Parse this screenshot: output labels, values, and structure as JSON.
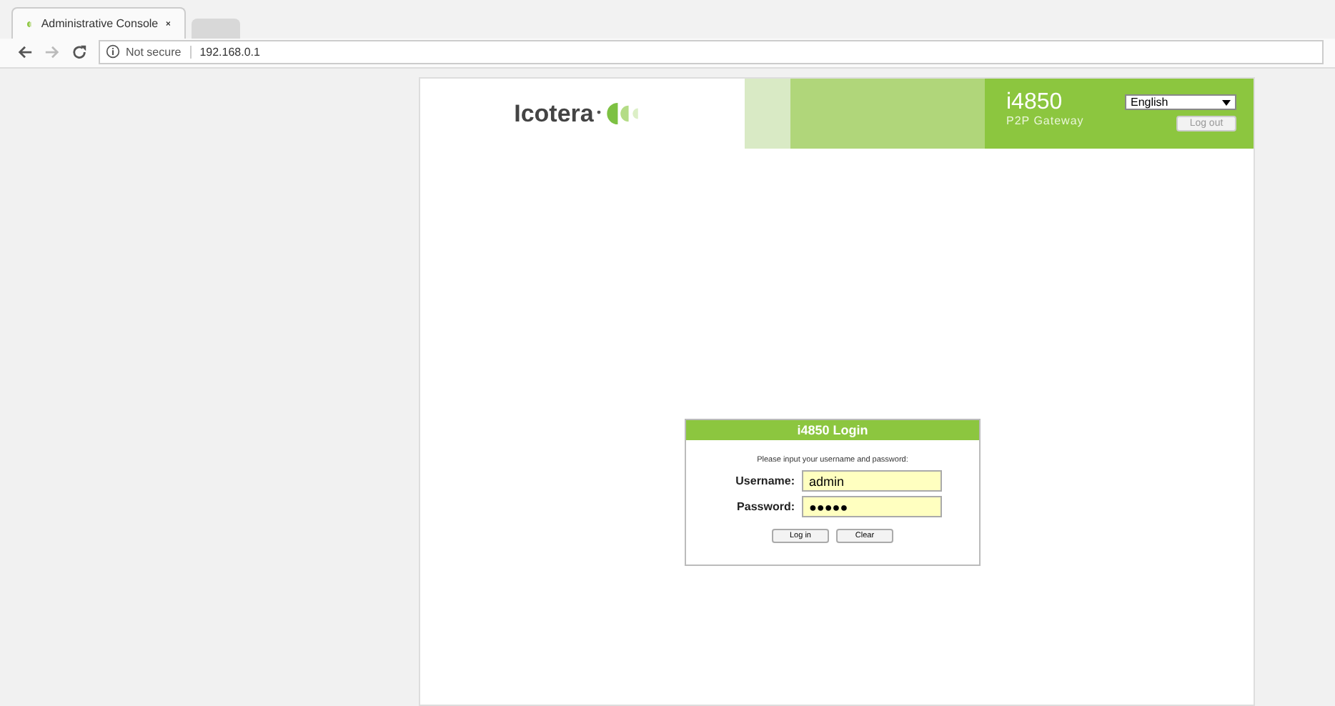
{
  "browser": {
    "tabs": [
      {
        "title": "Administrative Console",
        "selected": true
      },
      {
        "selected": false
      }
    ],
    "security": "Not secure",
    "url": "192.168.0.1"
  },
  "header": {
    "logo": "Icotera",
    "model": "i4850",
    "subtitle": "P2P Gateway",
    "language": "English",
    "logout": "Log out"
  },
  "login": {
    "title": "i4850 Login",
    "prompt": "Please input your username and password:",
    "fields": [
      {
        "label": "Username:",
        "value": "admin"
      },
      {
        "label": "Password:",
        "value": "●●●●●"
      }
    ],
    "buttons": [
      "Log in",
      "Clear"
    ]
  }
}
